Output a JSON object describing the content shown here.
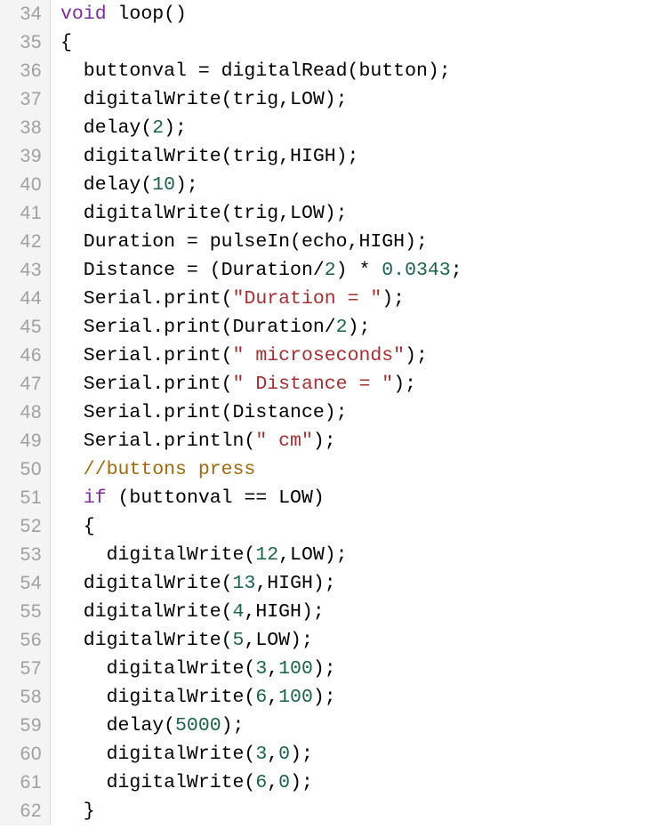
{
  "editor": {
    "language": "arduino-cpp",
    "first_visible_line": 34,
    "last_visible_line": 62,
    "colors": {
      "background": "#ffffff",
      "gutter_background": "#f4f4f4",
      "gutter_border": "#dcdcdc",
      "line_number": "#a0a0a0",
      "text": "#000000",
      "keyword": "#7b2d99",
      "string": "#a13033",
      "number": "#1c6247",
      "comment": "#9c6a10"
    }
  },
  "lines": [
    {
      "number": "34",
      "tokens": [
        {
          "t": "void",
          "c": "keyword"
        },
        {
          "t": " loop()",
          "c": "plain"
        }
      ]
    },
    {
      "number": "35",
      "tokens": [
        {
          "t": "{",
          "c": "plain"
        }
      ]
    },
    {
      "number": "36",
      "tokens": [
        {
          "t": "  buttonval = digitalRead(button);",
          "c": "plain"
        }
      ]
    },
    {
      "number": "37",
      "tokens": [
        {
          "t": "  digitalWrite(trig,LOW);",
          "c": "plain"
        }
      ]
    },
    {
      "number": "38",
      "tokens": [
        {
          "t": "  delay(",
          "c": "plain"
        },
        {
          "t": "2",
          "c": "number"
        },
        {
          "t": ");",
          "c": "plain"
        }
      ]
    },
    {
      "number": "39",
      "tokens": [
        {
          "t": "  digitalWrite(trig,HIGH);",
          "c": "plain"
        }
      ]
    },
    {
      "number": "40",
      "tokens": [
        {
          "t": "  delay(",
          "c": "plain"
        },
        {
          "t": "10",
          "c": "number"
        },
        {
          "t": ");",
          "c": "plain"
        }
      ]
    },
    {
      "number": "41",
      "tokens": [
        {
          "t": "  digitalWrite(trig,LOW);",
          "c": "plain"
        }
      ]
    },
    {
      "number": "42",
      "tokens": [
        {
          "t": "  Duration = pulseIn(echo,HIGH);",
          "c": "plain"
        }
      ]
    },
    {
      "number": "43",
      "tokens": [
        {
          "t": "  Distance = (Duration/",
          "c": "plain"
        },
        {
          "t": "2",
          "c": "number"
        },
        {
          "t": ") * ",
          "c": "plain"
        },
        {
          "t": "0.0343",
          "c": "number"
        },
        {
          "t": ";",
          "c": "plain"
        }
      ]
    },
    {
      "number": "44",
      "tokens": [
        {
          "t": "  Serial.print(",
          "c": "plain"
        },
        {
          "t": "\"Duration = \"",
          "c": "string"
        },
        {
          "t": ");",
          "c": "plain"
        }
      ]
    },
    {
      "number": "45",
      "tokens": [
        {
          "t": "  Serial.print(Duration/",
          "c": "plain"
        },
        {
          "t": "2",
          "c": "number"
        },
        {
          "t": ");",
          "c": "plain"
        }
      ]
    },
    {
      "number": "46",
      "tokens": [
        {
          "t": "  Serial.print(",
          "c": "plain"
        },
        {
          "t": "\" microseconds\"",
          "c": "string"
        },
        {
          "t": ");",
          "c": "plain"
        }
      ]
    },
    {
      "number": "47",
      "tokens": [
        {
          "t": "  Serial.print(",
          "c": "plain"
        },
        {
          "t": "\" Distance = \"",
          "c": "string"
        },
        {
          "t": ");",
          "c": "plain"
        }
      ]
    },
    {
      "number": "48",
      "tokens": [
        {
          "t": "  Serial.print(Distance);",
          "c": "plain"
        }
      ]
    },
    {
      "number": "49",
      "tokens": [
        {
          "t": "  Serial.println(",
          "c": "plain"
        },
        {
          "t": "\" cm\"",
          "c": "string"
        },
        {
          "t": ");",
          "c": "plain"
        }
      ]
    },
    {
      "number": "50",
      "tokens": [
        {
          "t": "  //buttons press",
          "c": "comment"
        }
      ]
    },
    {
      "number": "51",
      "tokens": [
        {
          "t": "  ",
          "c": "plain"
        },
        {
          "t": "if",
          "c": "keyword"
        },
        {
          "t": " (buttonval == LOW)",
          "c": "plain"
        }
      ]
    },
    {
      "number": "52",
      "tokens": [
        {
          "t": "  {",
          "c": "plain"
        }
      ]
    },
    {
      "number": "53",
      "tokens": [
        {
          "t": "    digitalWrite(",
          "c": "plain"
        },
        {
          "t": "12",
          "c": "number"
        },
        {
          "t": ",LOW);",
          "c": "plain"
        }
      ]
    },
    {
      "number": "54",
      "tokens": [
        {
          "t": "  digitalWrite(",
          "c": "plain"
        },
        {
          "t": "13",
          "c": "number"
        },
        {
          "t": ",HIGH);",
          "c": "plain"
        }
      ]
    },
    {
      "number": "55",
      "tokens": [
        {
          "t": "  digitalWrite(",
          "c": "plain"
        },
        {
          "t": "4",
          "c": "number"
        },
        {
          "t": ",HIGH);",
          "c": "plain"
        }
      ]
    },
    {
      "number": "56",
      "tokens": [
        {
          "t": "  digitalWrite(",
          "c": "plain"
        },
        {
          "t": "5",
          "c": "number"
        },
        {
          "t": ",LOW);",
          "c": "plain"
        }
      ]
    },
    {
      "number": "57",
      "tokens": [
        {
          "t": "    digitalWrite(",
          "c": "plain"
        },
        {
          "t": "3",
          "c": "number"
        },
        {
          "t": ",",
          "c": "plain"
        },
        {
          "t": "100",
          "c": "number"
        },
        {
          "t": ");",
          "c": "plain"
        }
      ]
    },
    {
      "number": "58",
      "tokens": [
        {
          "t": "    digitalWrite(",
          "c": "plain"
        },
        {
          "t": "6",
          "c": "number"
        },
        {
          "t": ",",
          "c": "plain"
        },
        {
          "t": "100",
          "c": "number"
        },
        {
          "t": ");",
          "c": "plain"
        }
      ]
    },
    {
      "number": "59",
      "tokens": [
        {
          "t": "    delay(",
          "c": "plain"
        },
        {
          "t": "5000",
          "c": "number"
        },
        {
          "t": ");",
          "c": "plain"
        }
      ]
    },
    {
      "number": "60",
      "tokens": [
        {
          "t": "    digitalWrite(",
          "c": "plain"
        },
        {
          "t": "3",
          "c": "number"
        },
        {
          "t": ",",
          "c": "plain"
        },
        {
          "t": "0",
          "c": "number"
        },
        {
          "t": ");",
          "c": "plain"
        }
      ]
    },
    {
      "number": "61",
      "tokens": [
        {
          "t": "    digitalWrite(",
          "c": "plain"
        },
        {
          "t": "6",
          "c": "number"
        },
        {
          "t": ",",
          "c": "plain"
        },
        {
          "t": "0",
          "c": "number"
        },
        {
          "t": ");",
          "c": "plain"
        }
      ]
    },
    {
      "number": "62",
      "tokens": [
        {
          "t": "  }",
          "c": "plain"
        }
      ]
    }
  ]
}
